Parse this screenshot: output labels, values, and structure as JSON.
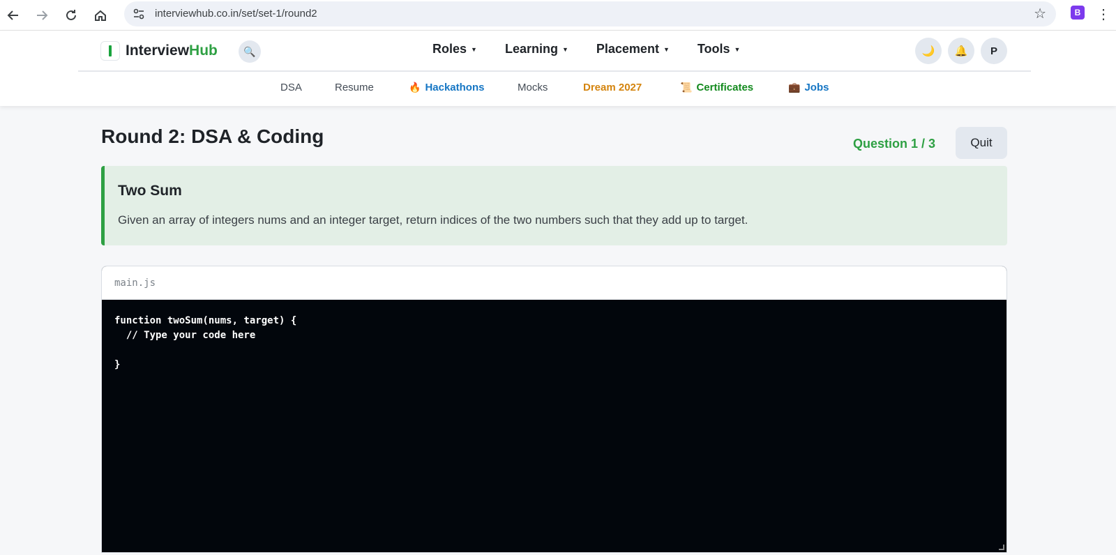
{
  "browser": {
    "url": "interviewhub.co.in/set/set-1/round2",
    "extension_label": "B"
  },
  "header": {
    "logo_main": "Interview",
    "logo_accent": "Hub",
    "nav": [
      {
        "label": "Roles"
      },
      {
        "label": "Learning"
      },
      {
        "label": "Placement"
      },
      {
        "label": "Tools"
      }
    ],
    "theme_icon": "🌙",
    "bell_icon": "🔔",
    "avatar_initial": "P"
  },
  "subnav": {
    "dsa": "DSA",
    "resume": "Resume",
    "hackathons": "Hackathons",
    "mocks": "Mocks",
    "dream": "Dream 2027",
    "certificates": "Certificates",
    "jobs": "Jobs"
  },
  "round": {
    "title": "Round 2: DSA & Coding",
    "progress": "Question 1 / 3",
    "quit_label": "Quit"
  },
  "problem": {
    "title": "Two Sum",
    "description": "Given an array of integers nums and an integer target, return indices of the two numbers such that they add up to target."
  },
  "editor": {
    "filename": "main.js",
    "code": "function twoSum(nums, target) {\n  // Type your code here\n\n}"
  },
  "colors": {
    "accent_green": "#2ea043",
    "link_blue": "#1676c4",
    "dream_orange": "#d4840e",
    "cert_green": "#138a1e",
    "editor_bg": "#02060c"
  }
}
